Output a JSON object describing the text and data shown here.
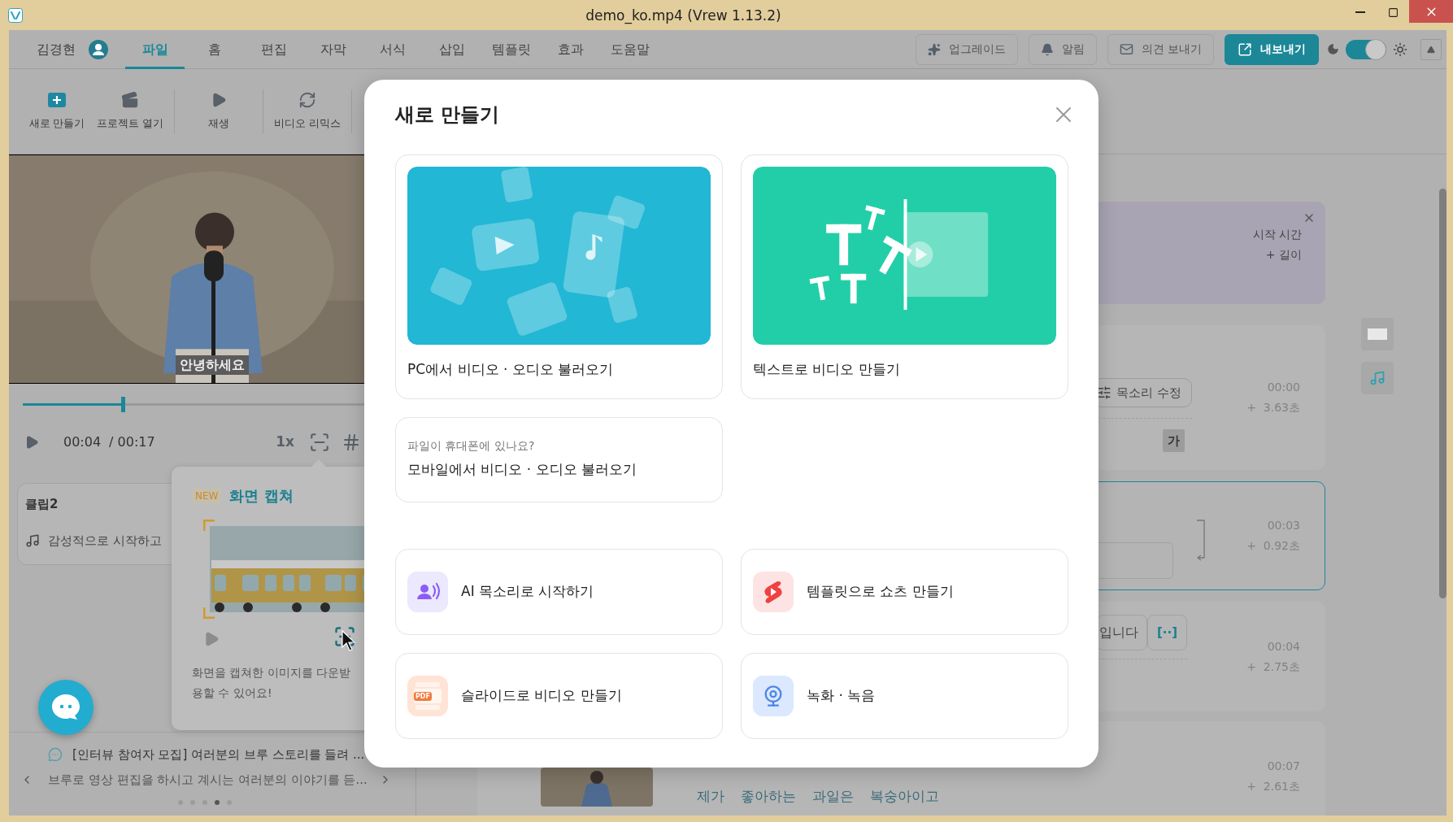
{
  "window": {
    "title": "demo_ko.mp4 (Vrew 1.13.2)"
  },
  "menu": {
    "user": "김경현",
    "tabs": [
      {
        "label": "파일",
        "selected": true
      },
      {
        "label": "홈",
        "selected": false
      },
      {
        "label": "편집",
        "selected": false
      },
      {
        "label": "자막",
        "selected": false
      },
      {
        "label": "서식",
        "selected": false
      },
      {
        "label": "삽입",
        "selected": false
      },
      {
        "label": "템플릿",
        "selected": false
      },
      {
        "label": "효과",
        "selected": false
      },
      {
        "label": "도움말",
        "selected": false
      }
    ],
    "actions": [
      {
        "label": "업그레이드",
        "kind": "upgrade"
      },
      {
        "label": "알림",
        "kind": "alerts"
      },
      {
        "label": "의견 보내기",
        "kind": "feedback"
      },
      {
        "label": "내보내기",
        "kind": "export"
      }
    ],
    "dark_mode": {
      "on": true
    }
  },
  "toolbar": [
    {
      "label": "새로 만들기",
      "kind": "new"
    },
    {
      "label": "프로젝트 열기",
      "kind": "open"
    },
    {
      "label": "재생",
      "kind": "play"
    },
    {
      "label": "비디오 리믹스",
      "kind": "remix"
    }
  ],
  "player": {
    "caption": "안녕하세요",
    "level": 0.26,
    "time": "00:04",
    "duration": "/ 00:17",
    "speed": "1x"
  },
  "clip": {
    "title": "클립2",
    "line": "감성적으로 시작하고"
  },
  "tip": {
    "badge": "NEW",
    "title": "화면 캡쳐",
    "lines": [
      "화면을 캡쳐한 이미지를 다운받",
      "용할 수 있어요!"
    ]
  },
  "notice": {
    "title": "[인터뷰 참여자 모집] 여러분의 브루 스토리를 들려 ...",
    "body": "브루로 영상 편집을 하시고 계시는 여러분의 이야기를 듣...",
    "dots": [
      {
        "selected": false
      },
      {
        "selected": false
      },
      {
        "selected": false
      },
      {
        "selected": true
      },
      {
        "selected": false
      }
    ]
  },
  "script": {
    "banner": [
      "시작 시간",
      "+ 길이"
    ],
    "rows": [
      {
        "kind": "voice",
        "selected": false,
        "start": "00:00",
        "length": "+  3.63초",
        "button": "목소리 수정",
        "chip": "가"
      },
      {
        "kind": "linked",
        "selected": true,
        "start": "00:03",
        "length": "+  0.92초"
      },
      {
        "kind": "words",
        "selected": false,
        "start": "00:04",
        "length": "+  2.75초",
        "word": "입니다",
        "tag": "[··]"
      },
      {
        "kind": "thumb",
        "selected": false,
        "start": "00:07",
        "length": "+  2.61초",
        "words": [
          "제가",
          "좋아하는",
          "과일은",
          "복숭아이고"
        ]
      }
    ]
  },
  "dialog": {
    "title": "새로 만들기",
    "featured": [
      {
        "label": "PC에서 비디오 · 오디오 불러오기",
        "kind": "import"
      },
      {
        "label": "텍스트로 비디오 만들기",
        "kind": "text"
      }
    ],
    "mobile": {
      "hint": "파일이 휴대폰에 있나요?",
      "label": "모바일에서 비디오 · 오디오 불러오기"
    },
    "options": [
      {
        "label": "AI 목소리로 시작하기",
        "kind": "voice"
      },
      {
        "label": "템플릿으로 쇼츠 만들기",
        "kind": "template"
      },
      {
        "label": "슬라이드로 비디오 만들기",
        "kind": "slides",
        "icon_text": "PDF"
      },
      {
        "label": "녹화 · 녹음",
        "kind": "record"
      }
    ]
  }
}
